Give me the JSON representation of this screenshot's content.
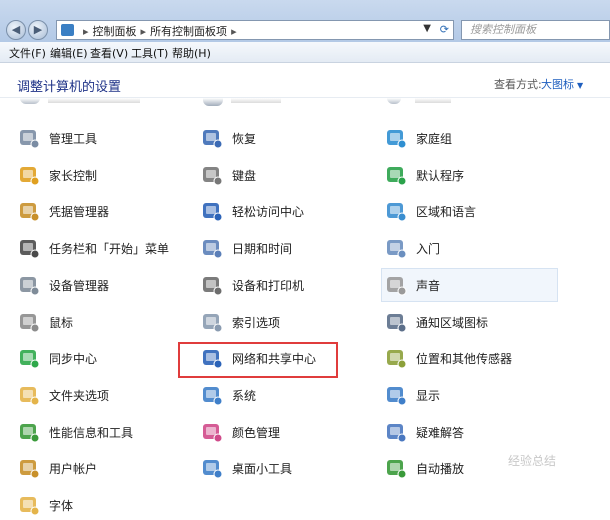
{
  "address": {
    "crumbs": [
      "控制面板",
      "所有控制面板项"
    ],
    "search_placeholder": "搜索控制面板"
  },
  "menu": [
    "文件(F)",
    "编辑(E)",
    "查看(V)",
    "工具(T)",
    "帮助(H)"
  ],
  "heading": "调整计算机的设置",
  "view_by_label": "查看方式:",
  "view_by_value": "大图标",
  "items": [
    {
      "label": "管理工具",
      "icon": "admin-tools-icon",
      "color": "#7a8ca3"
    },
    {
      "label": "恢复",
      "icon": "recovery-icon",
      "color": "#3c6bb5"
    },
    {
      "label": "家庭组",
      "icon": "homegroup-icon",
      "color": "#2f8fd1"
    },
    {
      "label": "家长控制",
      "icon": "parental-controls-icon",
      "color": "#e0a020"
    },
    {
      "label": "键盘",
      "icon": "keyboard-icon",
      "color": "#777777"
    },
    {
      "label": "默认程序",
      "icon": "default-programs-icon",
      "color": "#2aa24a"
    },
    {
      "label": "凭据管理器",
      "icon": "credential-manager-icon",
      "color": "#c8902a"
    },
    {
      "label": "轻松访问中心",
      "icon": "ease-of-access-icon",
      "color": "#2b63b8"
    },
    {
      "label": "区域和语言",
      "icon": "region-language-icon",
      "color": "#3a8ed0"
    },
    {
      "label": "任务栏和「开始」菜单",
      "icon": "taskbar-start-menu-icon",
      "color": "#4a4a4a"
    },
    {
      "label": "日期和时间",
      "icon": "date-time-icon",
      "color": "#5b7fb8"
    },
    {
      "label": "入门",
      "icon": "getting-started-icon",
      "color": "#6b8fbf"
    },
    {
      "label": "设备管理器",
      "icon": "device-manager-icon",
      "color": "#7f8c99"
    },
    {
      "label": "设备和打印机",
      "icon": "devices-printers-icon",
      "color": "#6d6d6d"
    },
    {
      "label": "声音",
      "icon": "sound-icon",
      "color": "#9a9a9a"
    },
    {
      "label": "鼠标",
      "icon": "mouse-icon",
      "color": "#8c8c8c"
    },
    {
      "label": "索引选项",
      "icon": "indexing-options-icon",
      "color": "#8a9bb0"
    },
    {
      "label": "通知区域图标",
      "icon": "notification-area-icon",
      "color": "#5c6f8a"
    },
    {
      "label": "同步中心",
      "icon": "sync-center-icon",
      "color": "#2ea84a"
    },
    {
      "label": "网络和共享中心",
      "icon": "network-sharing-icon",
      "color": "#2b63b8"
    },
    {
      "label": "位置和其他传感器",
      "icon": "location-sensors-icon",
      "color": "#8ca03a"
    },
    {
      "label": "文件夹选项",
      "icon": "folder-options-icon",
      "color": "#e4b44a"
    },
    {
      "label": "系统",
      "icon": "system-icon",
      "color": "#3f7fc9"
    },
    {
      "label": "显示",
      "icon": "display-icon",
      "color": "#3f7fc9"
    },
    {
      "label": "性能信息和工具",
      "icon": "performance-icon",
      "color": "#3a9a3a"
    },
    {
      "label": "颜色管理",
      "icon": "color-management-icon",
      "color": "#d04a8a"
    },
    {
      "label": "疑难解答",
      "icon": "troubleshooting-icon",
      "color": "#4a78c0"
    },
    {
      "label": "用户帐户",
      "icon": "user-accounts-icon",
      "color": "#c8902a"
    },
    {
      "label": "桌面小工具",
      "icon": "desktop-gadgets-icon",
      "color": "#3f7fc9"
    },
    {
      "label": "自动播放",
      "icon": "autoplay-icon",
      "color": "#3a9a3a"
    },
    {
      "label": "字体",
      "icon": "fonts-icon",
      "color": "#e4b44a"
    }
  ],
  "watermark": "经验总结"
}
